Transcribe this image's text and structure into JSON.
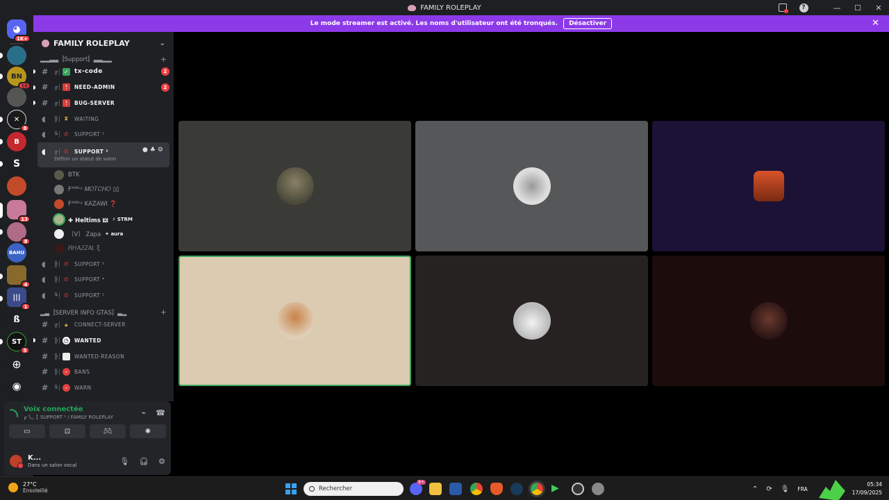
{
  "window": {
    "title": "FAMILY ROLEPLAY"
  },
  "banner": {
    "message": "Le mode streamer est activé. Les noms d'utilisateur ont été tronqués.",
    "button": "Désactiver"
  },
  "rail": {
    "home_badge": "1K+",
    "servers": [
      {
        "badge": ""
      },
      {
        "badge": "10"
      },
      {
        "badge": ""
      },
      {
        "badge": "8"
      },
      {
        "badge": ""
      },
      {
        "badge": ""
      },
      {
        "badge": ""
      },
      {
        "badge": "13"
      },
      {
        "badge": "8"
      },
      {
        "badge": ""
      },
      {
        "badge": "4"
      },
      {
        "badge": "1"
      },
      {
        "badge": ""
      },
      {
        "badge": "5"
      }
    ],
    "bahu_label": "BAHU"
  },
  "sidebar": {
    "server_name": "FAMILY ROLEPLAY",
    "category_support": "▂▂▃▃〚Support〛▃▃▂▂",
    "channels_a": [
      {
        "name": "tx-code",
        "badge": "2",
        "lower": true
      },
      {
        "name": "NEED-ADMIN",
        "badge": "2"
      },
      {
        "name": "BUG-SERVER",
        "badge": ""
      },
      {
        "name": "WAITING",
        "badge": ""
      },
      {
        "name": "SUPPORT ¹",
        "badge": ""
      }
    ],
    "active_channel": {
      "name": "SUPPORT ²",
      "status": "Définir un statut de salon"
    },
    "voice_users": [
      {
        "name": "BTK",
        "tag": ""
      },
      {
        "name": "Fᴬᴹᴵᴸʸ 𝑀𝑂𝑇𝐶𝐻𝑂 ▯▯",
        "tag": ""
      },
      {
        "name": "Fᴬᴹᴵᴸʸ KAZAWI ❓",
        "tag": ""
      },
      {
        "name": "✚ Heltims 🜲",
        "tag": "⚡ STRM"
      },
      {
        "name": "〔V〕 Zapa",
        "tag": "✦ aura"
      },
      {
        "name": "𝑅𝐻𝐴𝑍𝑍𝐴𝐿 ξ",
        "tag": ""
      }
    ],
    "channels_b": [
      {
        "name": "SUPPORT ³"
      },
      {
        "name": "SUPPORT ⁴"
      },
      {
        "name": "SUPPORT ⁵"
      }
    ],
    "category_info": "▂▃〚SERVER INFO GTAS〛▃▂",
    "channels_c": [
      {
        "name": "CONNECT-SERVER"
      },
      {
        "name": "WANTED"
      },
      {
        "name": "WANTED-REASON"
      },
      {
        "name": "BANS"
      },
      {
        "name": "WARN"
      }
    ]
  },
  "voice_panel": {
    "title": "Voix connectée",
    "subtitle": "╔ 📞 ╏ SUPPORT ² / FAMILY ROLEPLAY"
  },
  "user_panel": {
    "name": "K...",
    "status": "Dans un salon vocal"
  },
  "taskbar": {
    "temperature": "27°C",
    "weather": "Ensoleillé",
    "search_placeholder": "Rechercher",
    "discord_badge": "9+",
    "language": "FRA",
    "time": "05:34",
    "date": "17/09/2025"
  },
  "colors": {
    "accent_banner": "#8c3ae8",
    "speaking": "#3ba55d",
    "danger": "#f23f43",
    "connected": "#23a55a"
  }
}
